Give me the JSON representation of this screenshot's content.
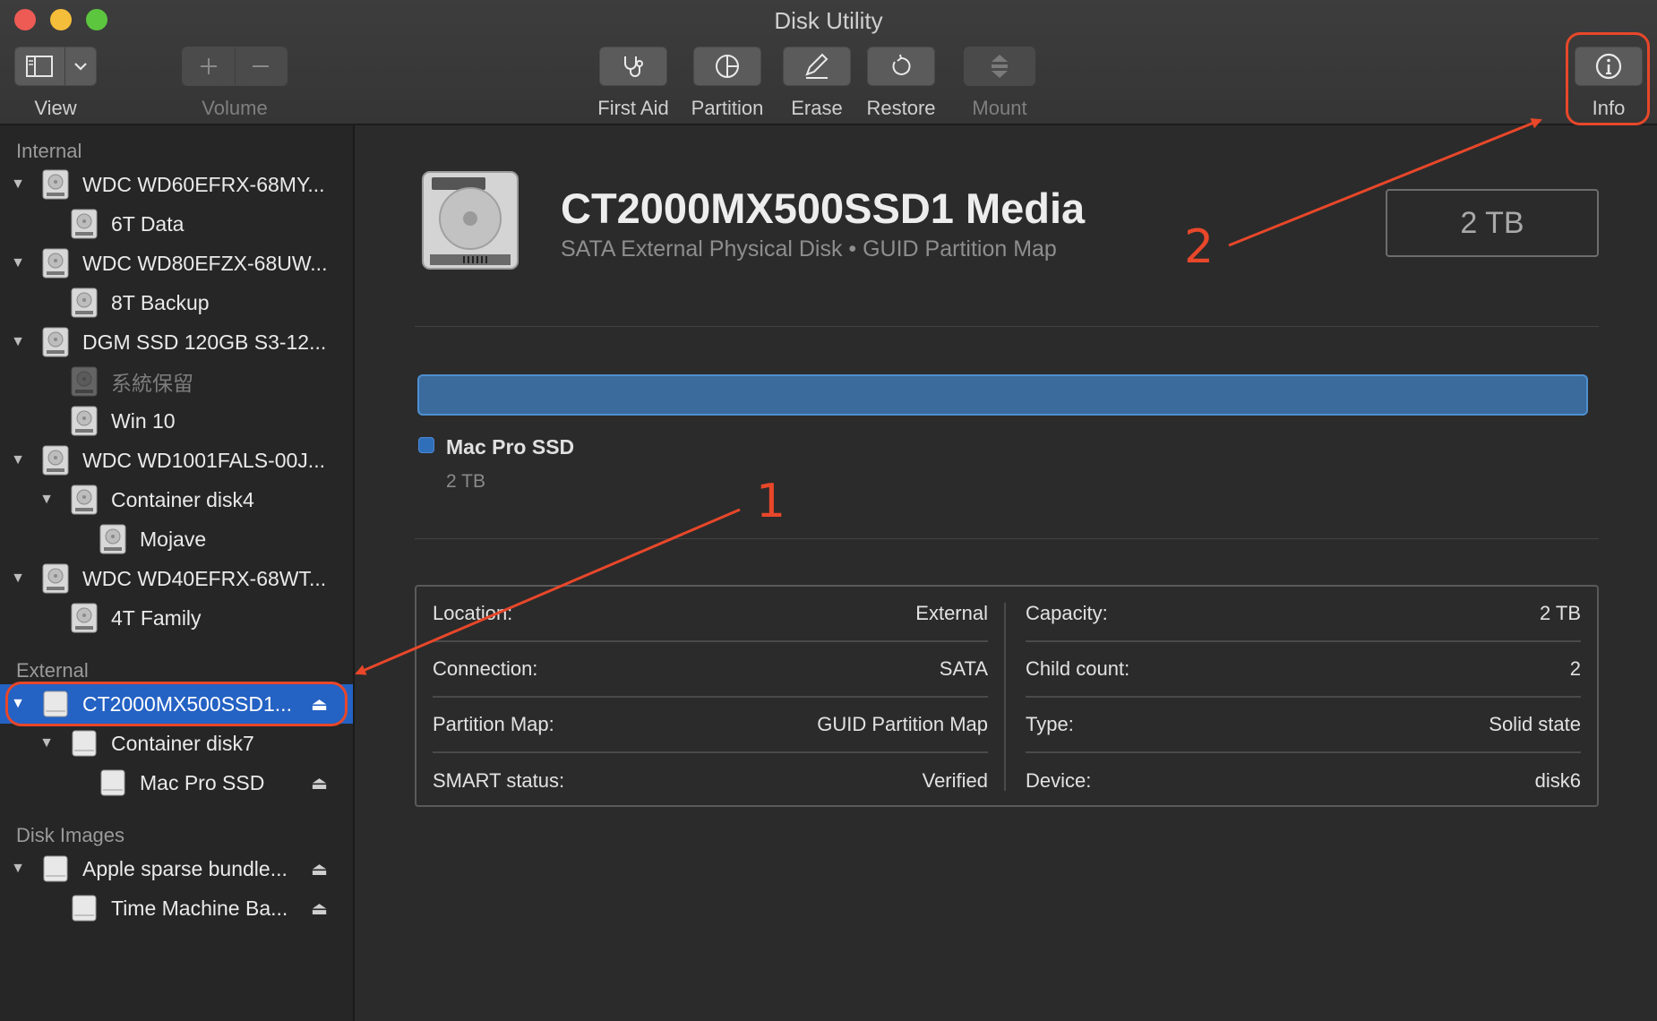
{
  "window": {
    "title": "Disk Utility"
  },
  "toolbar": {
    "view_label": "View",
    "volume_label": "Volume",
    "first_aid_label": "First Aid",
    "partition_label": "Partition",
    "erase_label": "Erase",
    "restore_label": "Restore",
    "mount_label": "Mount",
    "info_label": "Info"
  },
  "sidebar": {
    "internal_label": "Internal",
    "external_label": "External",
    "images_label": "Disk Images",
    "items": [
      {
        "label": "WDC WD60EFRX-68MY..."
      },
      {
        "label": "6T Data"
      },
      {
        "label": "WDC WD80EFZX-68UW..."
      },
      {
        "label": "8T Backup"
      },
      {
        "label": "DGM SSD 120GB S3-12..."
      },
      {
        "label": "系統保留"
      },
      {
        "label": "Win 10"
      },
      {
        "label": "WDC WD1001FALS-00J..."
      },
      {
        "label": "Container disk4"
      },
      {
        "label": "Mojave"
      },
      {
        "label": "WDC WD40EFRX-68WT..."
      },
      {
        "label": "4T Family"
      },
      {
        "label": "CT2000MX500SSD1..."
      },
      {
        "label": "Container disk7"
      },
      {
        "label": "Mac Pro SSD"
      },
      {
        "label": "Apple sparse bundle..."
      },
      {
        "label": "Time Machine Ba..."
      }
    ]
  },
  "main": {
    "disk_name": "CT2000MX500SSD1 Media",
    "disk_subtitle": "SATA External Physical Disk • GUID Partition Map",
    "disk_size": "2 TB",
    "partition": {
      "name": "Mac Pro SSD",
      "size": "2 TB"
    },
    "info_left": [
      {
        "key": "Location:",
        "value": "External"
      },
      {
        "key": "Connection:",
        "value": "SATA"
      },
      {
        "key": "Partition Map:",
        "value": "GUID Partition Map"
      },
      {
        "key": "SMART status:",
        "value": "Verified"
      }
    ],
    "info_right": [
      {
        "key": "Capacity:",
        "value": "2 TB"
      },
      {
        "key": "Child count:",
        "value": "2"
      },
      {
        "key": "Type:",
        "value": "Solid state"
      },
      {
        "key": "Device:",
        "value": "disk6"
      }
    ]
  },
  "annotations": {
    "one": "1",
    "two": "2"
  }
}
